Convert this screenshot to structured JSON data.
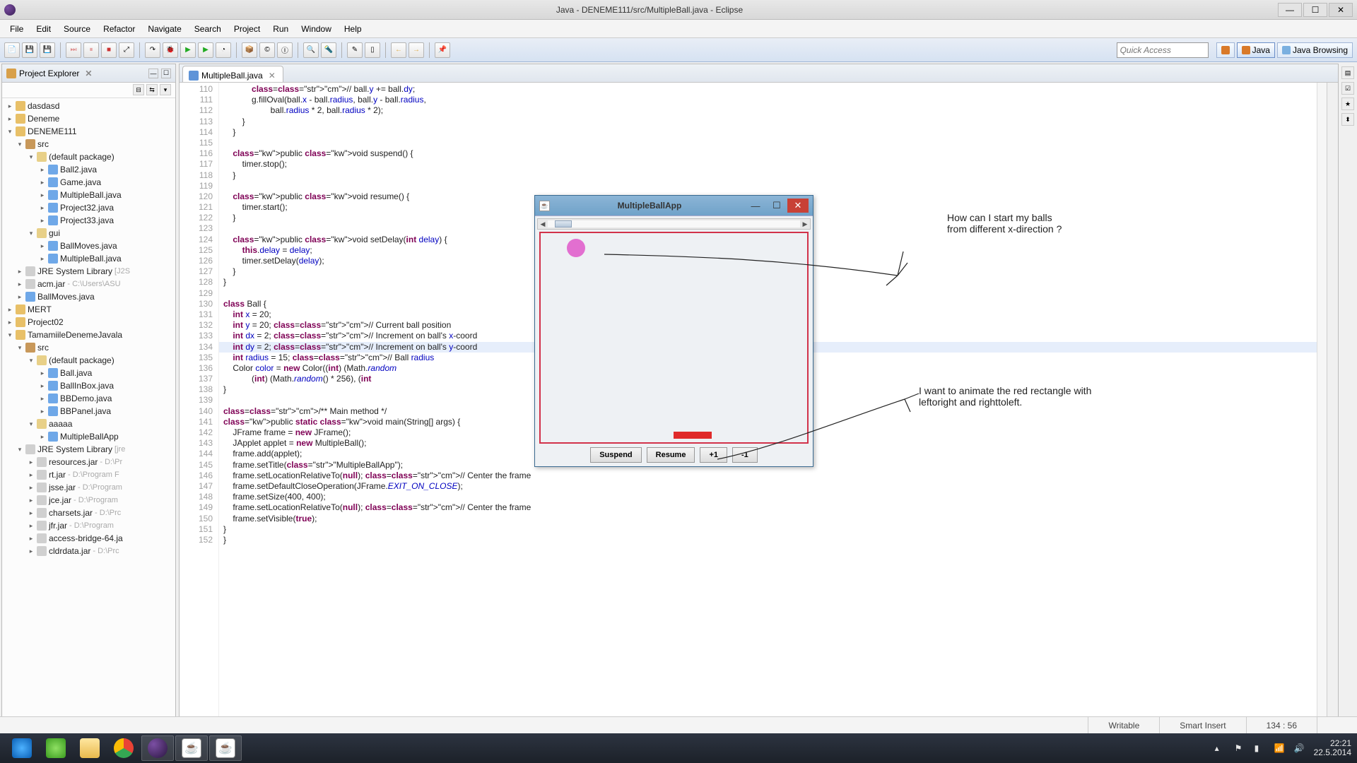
{
  "window": {
    "title": "Java - DENEME111/src/MultipleBall.java - Eclipse"
  },
  "menu": [
    "File",
    "Edit",
    "Source",
    "Refactor",
    "Navigate",
    "Search",
    "Project",
    "Run",
    "Window",
    "Help"
  ],
  "quick_access_placeholder": "Quick Access",
  "perspectives": [
    {
      "label": "Java",
      "active": true
    },
    {
      "label": "Java Browsing",
      "active": false
    }
  ],
  "package_explorer": {
    "title": "Project Explorer",
    "tree": [
      {
        "d": 0,
        "tw": "▸",
        "icon": "prj",
        "label": "dasdasd"
      },
      {
        "d": 0,
        "tw": "▸",
        "icon": "prj",
        "label": "Deneme"
      },
      {
        "d": 0,
        "tw": "▾",
        "icon": "prj",
        "label": "DENEME111"
      },
      {
        "d": 1,
        "tw": "▾",
        "icon": "pkg",
        "label": "src"
      },
      {
        "d": 2,
        "tw": "▾",
        "icon": "fld",
        "label": "(default package)"
      },
      {
        "d": 3,
        "tw": "▸",
        "icon": "ju",
        "label": "Ball2.java"
      },
      {
        "d": 3,
        "tw": "▸",
        "icon": "ju",
        "label": "Game.java"
      },
      {
        "d": 3,
        "tw": "▸",
        "icon": "ju",
        "label": "MultipleBall.java"
      },
      {
        "d": 3,
        "tw": "▸",
        "icon": "ju",
        "label": "Project32.java"
      },
      {
        "d": 3,
        "tw": "▸",
        "icon": "ju",
        "label": "Project33.java"
      },
      {
        "d": 2,
        "tw": "▾",
        "icon": "fld",
        "label": "gui"
      },
      {
        "d": 3,
        "tw": "▸",
        "icon": "ju",
        "label": "BallMoves.java"
      },
      {
        "d": 3,
        "tw": "▸",
        "icon": "ju",
        "label": "MultipleBall.java"
      },
      {
        "d": 1,
        "tw": "▸",
        "icon": "jar",
        "label": "JRE System Library",
        "suffix": "[J2S"
      },
      {
        "d": 1,
        "tw": "▸",
        "icon": "jar",
        "label": "acm.jar",
        "suffix": "- C:\\Users\\ASU"
      },
      {
        "d": 1,
        "tw": "▸",
        "icon": "ju",
        "label": "BallMoves.java"
      },
      {
        "d": 0,
        "tw": "▸",
        "icon": "prj",
        "label": "MERT"
      },
      {
        "d": 0,
        "tw": "▸",
        "icon": "prj",
        "label": "Project02"
      },
      {
        "d": 0,
        "tw": "▾",
        "icon": "prj",
        "label": "TamamiileDenemeJavala"
      },
      {
        "d": 1,
        "tw": "▾",
        "icon": "pkg",
        "label": "src"
      },
      {
        "d": 2,
        "tw": "▾",
        "icon": "fld",
        "label": "(default package)"
      },
      {
        "d": 3,
        "tw": "▸",
        "icon": "ju",
        "label": "Ball.java"
      },
      {
        "d": 3,
        "tw": "▸",
        "icon": "ju",
        "label": "BallInBox.java"
      },
      {
        "d": 3,
        "tw": "▸",
        "icon": "ju",
        "label": "BBDemo.java"
      },
      {
        "d": 3,
        "tw": "▸",
        "icon": "ju",
        "label": "BBPanel.java"
      },
      {
        "d": 2,
        "tw": "▾",
        "icon": "fld",
        "label": "aaaaa"
      },
      {
        "d": 3,
        "tw": "▸",
        "icon": "ju",
        "label": "MultipleBallApp"
      },
      {
        "d": 1,
        "tw": "▾",
        "icon": "jar",
        "label": "JRE System Library",
        "suffix": "[jre"
      },
      {
        "d": 2,
        "tw": "▸",
        "icon": "jar",
        "label": "resources.jar",
        "suffix": "- D:\\Pr"
      },
      {
        "d": 2,
        "tw": "▸",
        "icon": "jar",
        "label": "rt.jar",
        "suffix": "- D:\\Program F"
      },
      {
        "d": 2,
        "tw": "▸",
        "icon": "jar",
        "label": "jsse.jar",
        "suffix": "- D:\\Program"
      },
      {
        "d": 2,
        "tw": "▸",
        "icon": "jar",
        "label": "jce.jar",
        "suffix": "- D:\\Program"
      },
      {
        "d": 2,
        "tw": "▸",
        "icon": "jar",
        "label": "charsets.jar",
        "suffix": "- D:\\Prc"
      },
      {
        "d": 2,
        "tw": "▸",
        "icon": "jar",
        "label": "jfr.jar",
        "suffix": "- D:\\Program"
      },
      {
        "d": 2,
        "tw": "▸",
        "icon": "jar",
        "label": "access-bridge-64.ja"
      },
      {
        "d": 2,
        "tw": "▸",
        "icon": "jar",
        "label": "cldrdata.jar",
        "suffix": "- D:\\Prc"
      }
    ]
  },
  "editor": {
    "tab_label": "MultipleBall.java",
    "first_line": 110,
    "highlight_line": 134,
    "lines": [
      "            // ball.y += ball.dy;",
      "            g.fillOval(ball.x - ball.radius, ball.y - ball.radius,",
      "                    ball.radius * 2, ball.radius * 2);",
      "        }",
      "    }",
      "",
      "    public void suspend() {",
      "        timer.stop();",
      "    }",
      "",
      "    public void resume() {",
      "        timer.start();",
      "    }",
      "",
      "    public void setDelay(int delay) {",
      "        this.delay = delay;",
      "        timer.setDelay(delay);",
      "    }",
      "}",
      "",
      "class Ball {",
      "    int x = 20;",
      "    int y = 20; // Current ball position",
      "    int dx = 2; // Increment on ball's x-coord",
      "    int dy = 2; // Increment on ball's y-coord",
      "    int radius = 15; // Ball radius",
      "    Color color = new Color((int) (Math.random",
      "            (int) (Math.random() * 256), (int",
      "}",
      "",
      "/** Main method */",
      "public static void main(String[] args) {",
      "    JFrame frame = new JFrame();",
      "    JApplet applet = new MultipleBall();",
      "    frame.add(applet);",
      "    frame.setTitle(\"MultipleBallApp\");",
      "    frame.setLocationRelativeTo(null); // Center the frame",
      "    frame.setDefaultCloseOperation(JFrame.EXIT_ON_CLOSE);",
      "    frame.setSize(400, 400);",
      "    frame.setLocationRelativeTo(null); // Center the frame",
      "    frame.setVisible(true);",
      "}",
      "}"
    ]
  },
  "applet": {
    "title": "MultipleBallApp",
    "buttons": [
      "Suspend",
      "Resume",
      "+1",
      "-1"
    ]
  },
  "annotations": {
    "top": "How can I start my balls\nfrom different x-direction ?",
    "bottom": "I want to animate the red rectangle with\nleftoright and righttoleft."
  },
  "status": {
    "writable": "Writable",
    "insert": "Smart Insert",
    "pos": "134 : 56"
  },
  "taskbar": {
    "time": "22:21",
    "date": "22.5.2014"
  }
}
